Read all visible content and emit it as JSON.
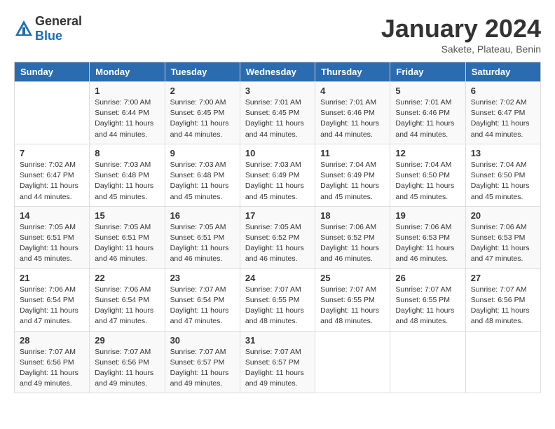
{
  "header": {
    "logo": {
      "general": "General",
      "blue": "Blue"
    },
    "title": "January 2024",
    "location": "Sakete, Plateau, Benin"
  },
  "calendar": {
    "days_of_week": [
      "Sunday",
      "Monday",
      "Tuesday",
      "Wednesday",
      "Thursday",
      "Friday",
      "Saturday"
    ],
    "weeks": [
      [
        {
          "day": "",
          "info": ""
        },
        {
          "day": "1",
          "info": "Sunrise: 7:00 AM\nSunset: 6:44 PM\nDaylight: 11 hours\nand 44 minutes."
        },
        {
          "day": "2",
          "info": "Sunrise: 7:00 AM\nSunset: 6:45 PM\nDaylight: 11 hours\nand 44 minutes."
        },
        {
          "day": "3",
          "info": "Sunrise: 7:01 AM\nSunset: 6:45 PM\nDaylight: 11 hours\nand 44 minutes."
        },
        {
          "day": "4",
          "info": "Sunrise: 7:01 AM\nSunset: 6:46 PM\nDaylight: 11 hours\nand 44 minutes."
        },
        {
          "day": "5",
          "info": "Sunrise: 7:01 AM\nSunset: 6:46 PM\nDaylight: 11 hours\nand 44 minutes."
        },
        {
          "day": "6",
          "info": "Sunrise: 7:02 AM\nSunset: 6:47 PM\nDaylight: 11 hours\nand 44 minutes."
        }
      ],
      [
        {
          "day": "7",
          "info": "Sunrise: 7:02 AM\nSunset: 6:47 PM\nDaylight: 11 hours\nand 44 minutes."
        },
        {
          "day": "8",
          "info": "Sunrise: 7:03 AM\nSunset: 6:48 PM\nDaylight: 11 hours\nand 45 minutes."
        },
        {
          "day": "9",
          "info": "Sunrise: 7:03 AM\nSunset: 6:48 PM\nDaylight: 11 hours\nand 45 minutes."
        },
        {
          "day": "10",
          "info": "Sunrise: 7:03 AM\nSunset: 6:49 PM\nDaylight: 11 hours\nand 45 minutes."
        },
        {
          "day": "11",
          "info": "Sunrise: 7:04 AM\nSunset: 6:49 PM\nDaylight: 11 hours\nand 45 minutes."
        },
        {
          "day": "12",
          "info": "Sunrise: 7:04 AM\nSunset: 6:50 PM\nDaylight: 11 hours\nand 45 minutes."
        },
        {
          "day": "13",
          "info": "Sunrise: 7:04 AM\nSunset: 6:50 PM\nDaylight: 11 hours\nand 45 minutes."
        }
      ],
      [
        {
          "day": "14",
          "info": "Sunrise: 7:05 AM\nSunset: 6:51 PM\nDaylight: 11 hours\nand 45 minutes."
        },
        {
          "day": "15",
          "info": "Sunrise: 7:05 AM\nSunset: 6:51 PM\nDaylight: 11 hours\nand 46 minutes."
        },
        {
          "day": "16",
          "info": "Sunrise: 7:05 AM\nSunset: 6:51 PM\nDaylight: 11 hours\nand 46 minutes."
        },
        {
          "day": "17",
          "info": "Sunrise: 7:05 AM\nSunset: 6:52 PM\nDaylight: 11 hours\nand 46 minutes."
        },
        {
          "day": "18",
          "info": "Sunrise: 7:06 AM\nSunset: 6:52 PM\nDaylight: 11 hours\nand 46 minutes."
        },
        {
          "day": "19",
          "info": "Sunrise: 7:06 AM\nSunset: 6:53 PM\nDaylight: 11 hours\nand 46 minutes."
        },
        {
          "day": "20",
          "info": "Sunrise: 7:06 AM\nSunset: 6:53 PM\nDaylight: 11 hours\nand 47 minutes."
        }
      ],
      [
        {
          "day": "21",
          "info": "Sunrise: 7:06 AM\nSunset: 6:54 PM\nDaylight: 11 hours\nand 47 minutes."
        },
        {
          "day": "22",
          "info": "Sunrise: 7:06 AM\nSunset: 6:54 PM\nDaylight: 11 hours\nand 47 minutes."
        },
        {
          "day": "23",
          "info": "Sunrise: 7:07 AM\nSunset: 6:54 PM\nDaylight: 11 hours\nand 47 minutes."
        },
        {
          "day": "24",
          "info": "Sunrise: 7:07 AM\nSunset: 6:55 PM\nDaylight: 11 hours\nand 48 minutes."
        },
        {
          "day": "25",
          "info": "Sunrise: 7:07 AM\nSunset: 6:55 PM\nDaylight: 11 hours\nand 48 minutes."
        },
        {
          "day": "26",
          "info": "Sunrise: 7:07 AM\nSunset: 6:55 PM\nDaylight: 11 hours\nand 48 minutes."
        },
        {
          "day": "27",
          "info": "Sunrise: 7:07 AM\nSunset: 6:56 PM\nDaylight: 11 hours\nand 48 minutes."
        }
      ],
      [
        {
          "day": "28",
          "info": "Sunrise: 7:07 AM\nSunset: 6:56 PM\nDaylight: 11 hours\nand 49 minutes."
        },
        {
          "day": "29",
          "info": "Sunrise: 7:07 AM\nSunset: 6:56 PM\nDaylight: 11 hours\nand 49 minutes."
        },
        {
          "day": "30",
          "info": "Sunrise: 7:07 AM\nSunset: 6:57 PM\nDaylight: 11 hours\nand 49 minutes."
        },
        {
          "day": "31",
          "info": "Sunrise: 7:07 AM\nSunset: 6:57 PM\nDaylight: 11 hours\nand 49 minutes."
        },
        {
          "day": "",
          "info": ""
        },
        {
          "day": "",
          "info": ""
        },
        {
          "day": "",
          "info": ""
        }
      ]
    ]
  }
}
